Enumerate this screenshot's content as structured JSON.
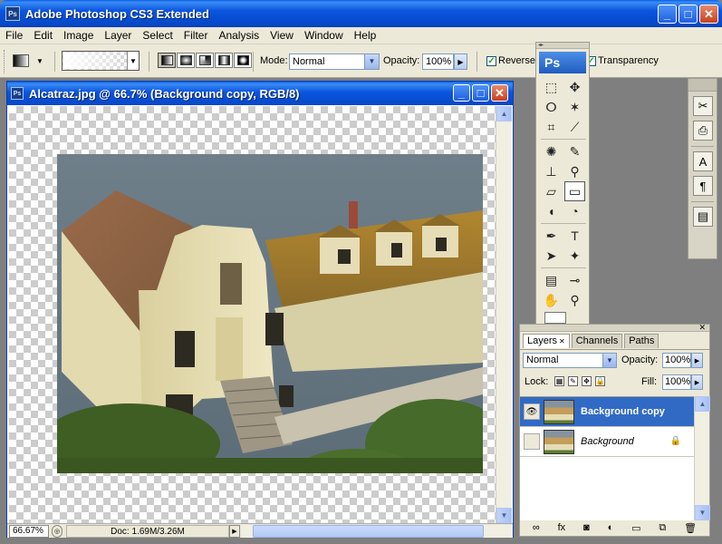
{
  "app": {
    "title": "Adobe Photoshop CS3 Extended",
    "icon_label": "Ps",
    "window_buttons": {
      "minimize": "_",
      "maximize": "□",
      "close": "✕"
    }
  },
  "menu": [
    "File",
    "Edit",
    "Image",
    "Layer",
    "Select",
    "Filter",
    "Analysis",
    "View",
    "Window",
    "Help"
  ],
  "options": {
    "mode_label": "Mode:",
    "mode_value": "Normal",
    "opacity_label": "Opacity:",
    "opacity_value": "100%",
    "reverse_label": "Reverse",
    "reverse_checked": true,
    "transparency_label": "Transparency",
    "transparency_checked": true
  },
  "document": {
    "title": "Alcatraz.jpg @ 66.7% (Background copy, RGB/8)",
    "zoom": "66.67%",
    "doc_info": "Doc: 1.69M/3.26M"
  },
  "tools": {
    "badge": "Ps",
    "items": [
      {
        "name": "marquee-tool-icon",
        "glyph": "⬚",
        "active": false
      },
      {
        "name": "move-tool-icon",
        "glyph": "✥",
        "active": false
      },
      {
        "name": "lasso-tool-icon",
        "glyph": "ⵔ",
        "active": false
      },
      {
        "name": "magic-wand-tool-icon",
        "glyph": "✶",
        "active": false
      },
      {
        "name": "crop-tool-icon",
        "glyph": "⌗",
        "active": false
      },
      {
        "name": "slice-tool-icon",
        "glyph": "⟋",
        "active": false
      },
      {
        "name": "healing-brush-tool-icon",
        "glyph": "✺",
        "active": false
      },
      {
        "name": "brush-tool-icon",
        "glyph": "✎",
        "active": false
      },
      {
        "name": "clone-stamp-tool-icon",
        "glyph": "⊥",
        "active": false
      },
      {
        "name": "history-brush-tool-icon",
        "glyph": "⚲",
        "active": false
      },
      {
        "name": "eraser-tool-icon",
        "glyph": "▱",
        "active": false
      },
      {
        "name": "gradient-tool-icon",
        "glyph": "▭",
        "active": true
      },
      {
        "name": "blur-tool-icon",
        "glyph": "◖",
        "active": false
      },
      {
        "name": "dodge-tool-icon",
        "glyph": "◔",
        "active": false
      },
      {
        "name": "pen-tool-icon",
        "glyph": "✒",
        "active": false
      },
      {
        "name": "type-tool-icon",
        "glyph": "T",
        "active": false
      },
      {
        "name": "path-selection-tool-icon",
        "glyph": "➤",
        "active": false
      },
      {
        "name": "shape-tool-icon",
        "glyph": "✦",
        "active": false
      },
      {
        "name": "notes-tool-icon",
        "glyph": "▤",
        "active": false
      },
      {
        "name": "eyedropper-tool-icon",
        "glyph": "⊸",
        "active": false
      },
      {
        "name": "hand-tool-icon",
        "glyph": "✋",
        "active": false
      },
      {
        "name": "zoom-tool-icon",
        "glyph": "⚲",
        "active": false
      }
    ]
  },
  "dock": [
    "✂",
    "⎙",
    "A",
    "¶",
    "▤"
  ],
  "layers": {
    "tabs": [
      {
        "label": "Layers",
        "active": true
      },
      {
        "label": "Channels",
        "active": false
      },
      {
        "label": "Paths",
        "active": false
      }
    ],
    "blend_mode": "Normal",
    "opacity_label": "Opacity:",
    "opacity_value": "100%",
    "lock_label": "Lock:",
    "fill_label": "Fill:",
    "fill_value": "100%",
    "list": [
      {
        "name": "Background copy",
        "selected": true,
        "visible": true,
        "locked": false
      },
      {
        "name": "Background",
        "selected": false,
        "visible": false,
        "locked": true
      }
    ],
    "footer_icons": [
      "∞",
      "fx",
      "◙",
      "◐",
      "▭",
      "⧉",
      "🗑"
    ]
  }
}
